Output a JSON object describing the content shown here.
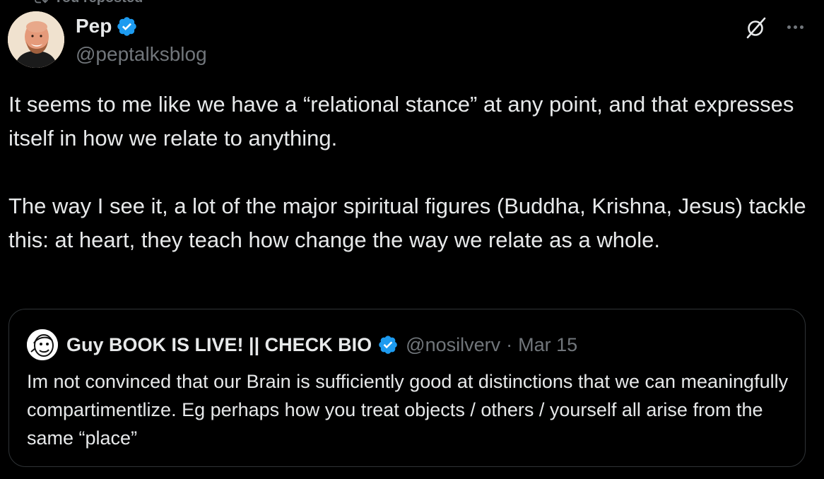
{
  "repost": {
    "label": "You reposted"
  },
  "tweet": {
    "author": {
      "display_name": "Pep",
      "handle": "@peptalksblog"
    },
    "paragraphs": [
      "It seems to me like we have a “relational stance” at any point, and that expresses itself in how we relate to anything.",
      "The way I see it, a lot of the major spiritual figures (Buddha, Krishna, Jesus) tackle this: at heart, they teach how change the way we relate as a whole."
    ]
  },
  "quote": {
    "author": {
      "display_name": "Guy BOOK IS LIVE! || CHECK BIO",
      "handle": "@nosilverv",
      "separator": "·",
      "date": "Mar 15"
    },
    "text": "Im not convinced that our Brain is sufficiently good at distinctions that we can meaningfully compartimentlize. Eg perhaps how you treat objects / others / yourself all arise from the same “place”"
  },
  "icons": {
    "verified": "verified-badge-icon",
    "grok": "grok-icon",
    "more": "more-options-icon",
    "repost": "repost-icon"
  },
  "colors": {
    "background": "#000000",
    "text_primary": "#e7e9ea",
    "text_secondary": "#71767b",
    "verified_blue": "#1d9bf0",
    "border": "#2f3336"
  }
}
